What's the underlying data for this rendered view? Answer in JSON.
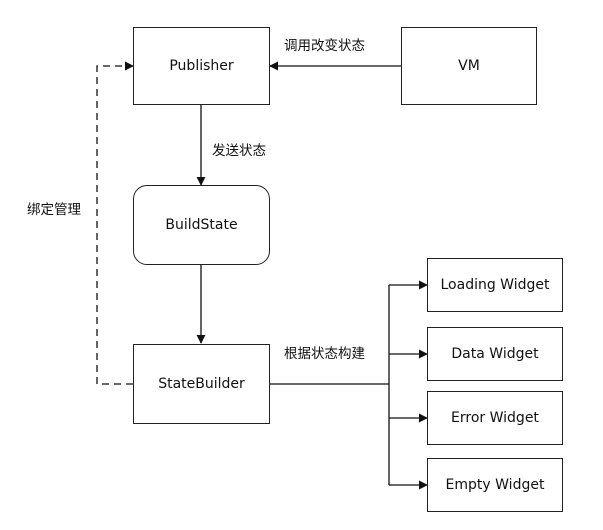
{
  "nodes": {
    "publisher": "Publisher",
    "vm": "VM",
    "build_state": "BuildState",
    "state_builder": "StateBuilder",
    "loading_widget": "Loading Widget",
    "data_widget": "Data Widget",
    "error_widget": "Error Widget",
    "empty_widget": "Empty Widget"
  },
  "edges": {
    "vm_to_publisher": "调用改变状态",
    "publisher_to_buildstate": "发送状态",
    "statebuilder_to_widgets": "根据状态构建",
    "binding": "绑定管理"
  }
}
